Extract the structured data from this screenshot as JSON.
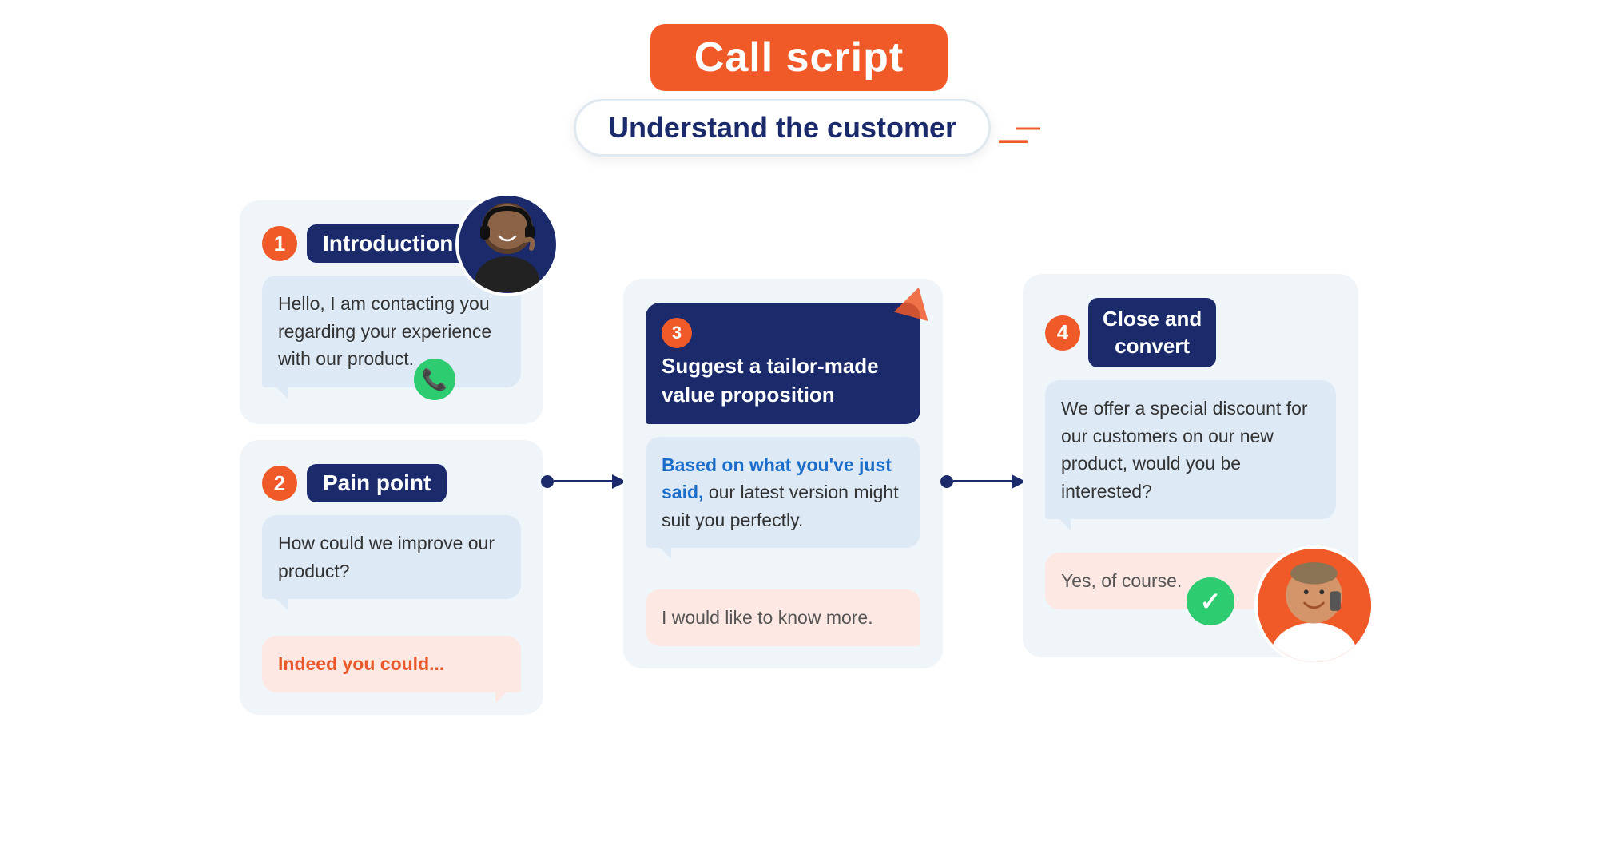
{
  "title": "Call script",
  "subtitle": "Understand the customer",
  "steps": [
    {
      "number": "1",
      "label": "Introduction",
      "bubble_agent": "Hello, I am contacting you regarding your experience with our product.",
      "has_avatar": true
    },
    {
      "number": "2",
      "label": "Pain point",
      "bubble_agent": "How could we improve our product?",
      "bubble_customer": "Indeed you could..."
    },
    {
      "number": "3",
      "label": "Suggest a tailor-made value proposition",
      "bubble_highlight": "Based on what you've just said,",
      "bubble_agent_rest": " our latest version might suit you perfectly.",
      "bubble_customer": "I would like to know more."
    },
    {
      "number": "4",
      "label_line1": "Close and",
      "label_line2": "convert",
      "bubble_agent": "We offer a special discount for our customers on our new product, would you be interested?",
      "bubble_customer": "Yes, of course.",
      "has_avatar": true
    }
  ],
  "colors": {
    "navy": "#1a2a6b",
    "orange": "#f05a28",
    "green": "#2ecc71",
    "bubble_blue": "#dde9f5",
    "bubble_pink": "#fde8e4",
    "panel_bg": "#f0f5fa"
  }
}
